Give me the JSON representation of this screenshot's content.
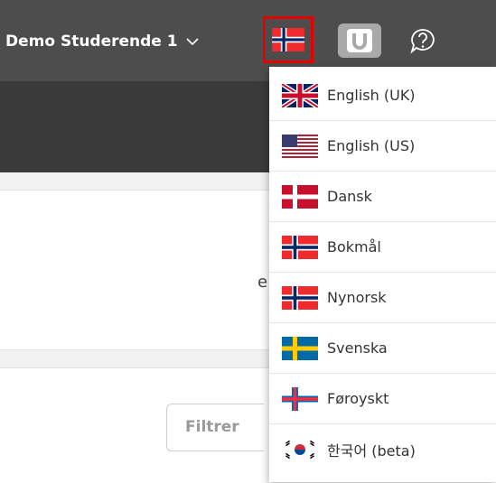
{
  "header": {
    "user_name": "Demo Studerende 1",
    "language_button_icon": "norway-flag-icon",
    "u_button_label": "U",
    "help_icon": "help-icon"
  },
  "page": {
    "filter_placeholder": "Filtrer",
    "snippet_text": "e"
  },
  "language_menu": {
    "items": [
      {
        "label": "English (UK)",
        "flag": "uk-flag-icon"
      },
      {
        "label": "English (US)",
        "flag": "us-flag-icon"
      },
      {
        "label": "Dansk",
        "flag": "denmark-flag-icon"
      },
      {
        "label": "Bokmål",
        "flag": "norway-flag-icon"
      },
      {
        "label": "Nynorsk",
        "flag": "norway-flag-icon"
      },
      {
        "label": "Svenska",
        "flag": "sweden-flag-icon"
      },
      {
        "label": "Føroyskt",
        "flag": "faroe-flag-icon"
      },
      {
        "label": "한국어 (beta)",
        "flag": "korea-flag-icon"
      }
    ]
  },
  "colors": {
    "topbar": "#4d4d4d",
    "subbar": "#3a3a3a",
    "highlight_border": "#e60000"
  }
}
